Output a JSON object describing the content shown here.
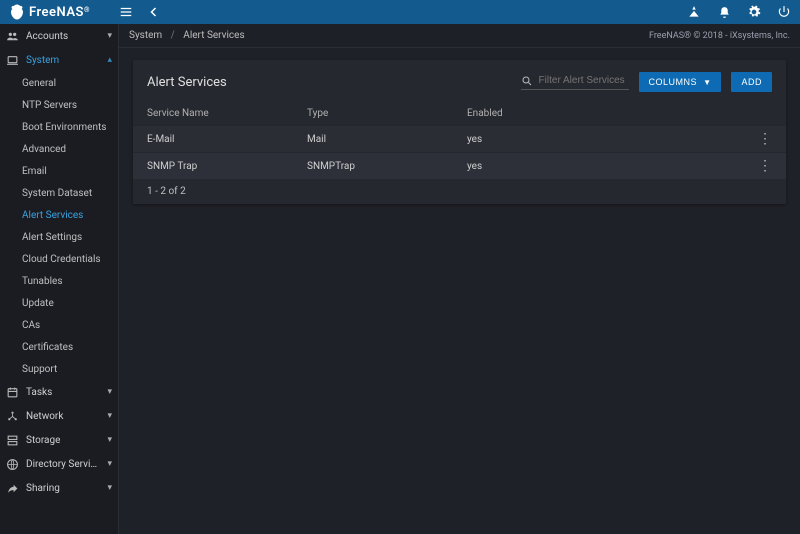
{
  "brand": {
    "name": "FreeNAS"
  },
  "breadcrumb": {
    "root": "System",
    "current": "Alert Services"
  },
  "copyright": "FreeNAS® © 2018 - iXsystems, Inc.",
  "sidebar": {
    "groups": [
      {
        "label": "Accounts",
        "icon": "users",
        "expanded": false
      },
      {
        "label": "System",
        "icon": "laptop",
        "expanded": true,
        "active": true,
        "children": [
          {
            "label": "General"
          },
          {
            "label": "NTP Servers"
          },
          {
            "label": "Boot Environments"
          },
          {
            "label": "Advanced"
          },
          {
            "label": "Email"
          },
          {
            "label": "System Dataset"
          },
          {
            "label": "Alert Services",
            "active": true
          },
          {
            "label": "Alert Settings"
          },
          {
            "label": "Cloud Credentials"
          },
          {
            "label": "Tunables"
          },
          {
            "label": "Update"
          },
          {
            "label": "CAs"
          },
          {
            "label": "Certificates"
          },
          {
            "label": "Support"
          }
        ]
      },
      {
        "label": "Tasks",
        "icon": "calendar",
        "expanded": false
      },
      {
        "label": "Network",
        "icon": "network",
        "expanded": false
      },
      {
        "label": "Storage",
        "icon": "storage",
        "expanded": false
      },
      {
        "label": "Directory Services",
        "icon": "globe",
        "expanded": false
      },
      {
        "label": "Sharing",
        "icon": "share",
        "expanded": false
      }
    ]
  },
  "panel": {
    "title": "Alert Services",
    "search_placeholder": "Filter Alert Services",
    "columns_btn": "COLUMNS",
    "add_btn": "ADD",
    "columns": {
      "c0": "Service Name",
      "c1": "Type",
      "c2": "Enabled"
    },
    "rows": [
      {
        "name": "E-Mail",
        "type": "Mail",
        "enabled": "yes"
      },
      {
        "name": "SNMP Trap",
        "type": "SNMPTrap",
        "enabled": "yes"
      }
    ],
    "footer": "1 - 2 of 2"
  }
}
